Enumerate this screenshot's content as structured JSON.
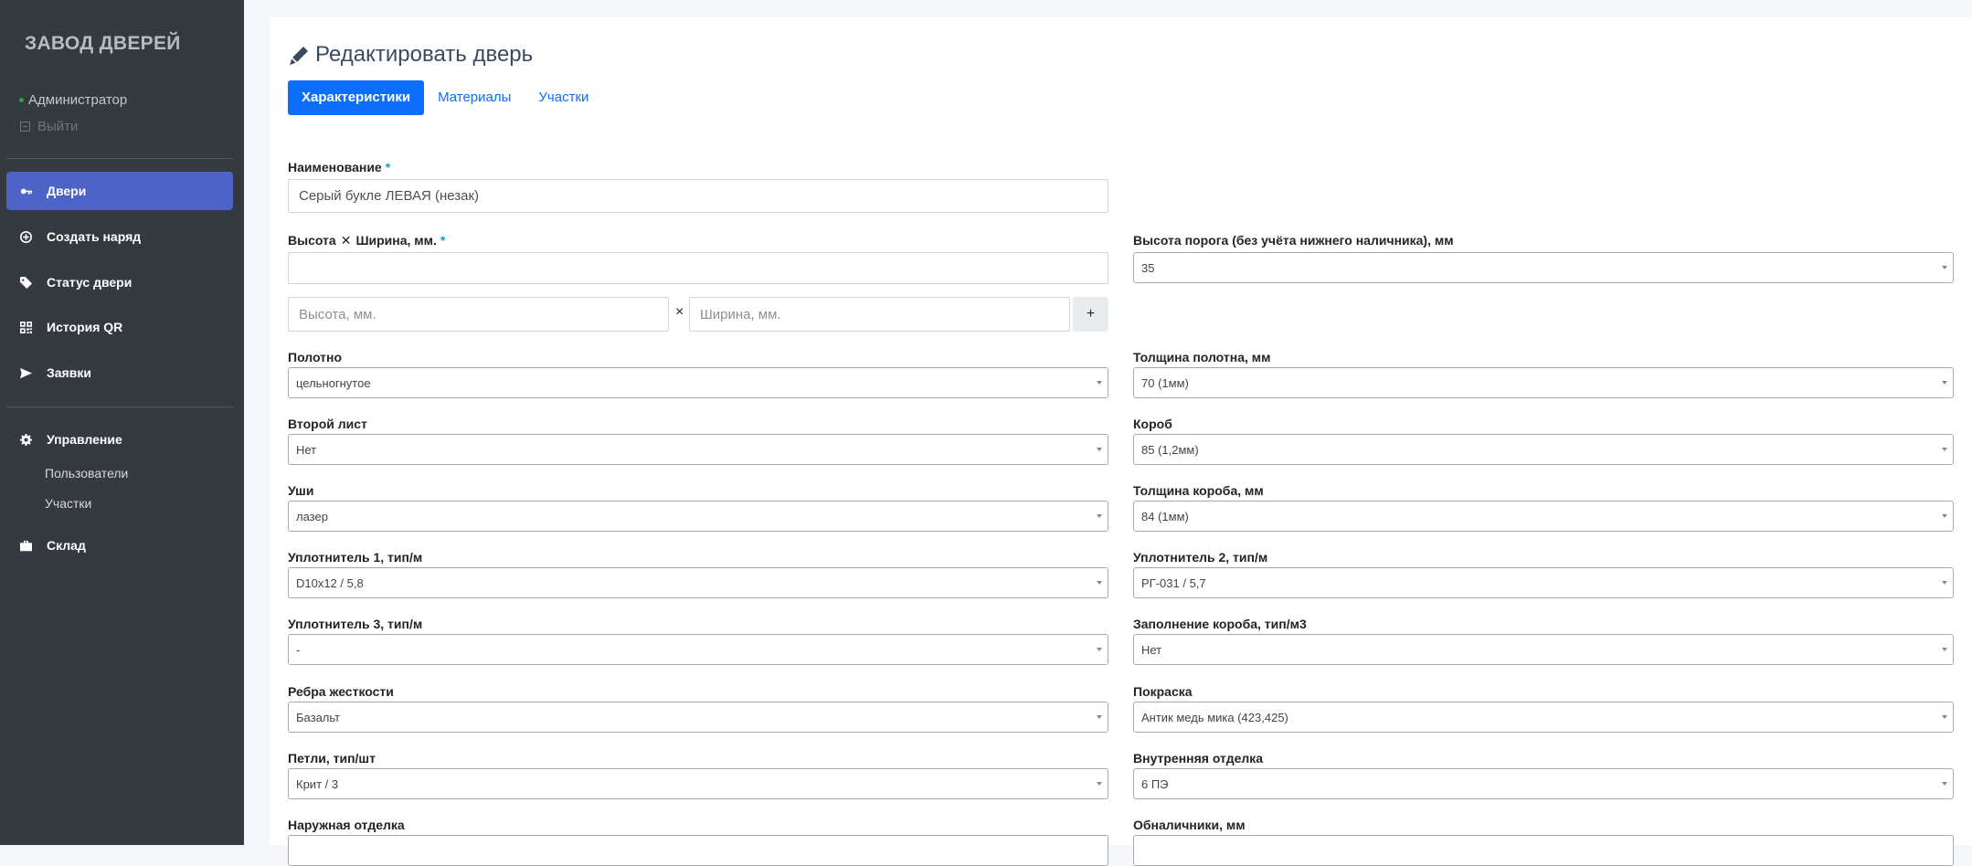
{
  "sidebar": {
    "brand": "ЗАВОД ДВЕРЕЙ",
    "user": "Администратор",
    "logout": "Выйти",
    "nav": [
      {
        "label": "Двери",
        "icon": "key-icon"
      },
      {
        "label": "Создать наряд",
        "icon": "plus-circle-icon"
      },
      {
        "label": "Статус двери",
        "icon": "tag-icon"
      },
      {
        "label": "История QR",
        "icon": "qrcode-icon"
      },
      {
        "label": "Заявки",
        "icon": "paper-plane-icon"
      }
    ],
    "management": {
      "label": "Управление",
      "icon": "gear-icon"
    },
    "sub_items": [
      "Пользователи",
      "Участки"
    ],
    "warehouse": {
      "label": "Склад",
      "icon": "briefcase-icon"
    }
  },
  "main": {
    "title": "Редактировать дверь",
    "tabs": [
      "Характеристики",
      "Материалы",
      "Участки"
    ],
    "name": {
      "label": "Наименование",
      "value": "Серый букле ЛЕВАЯ (незак)"
    },
    "size": {
      "label_height": "Высота",
      "times": "✕",
      "label_width": "Ширина, мм.",
      "height_placeholder": "Высота, мм.",
      "width_placeholder": "Ширина, мм.",
      "times_small": "×",
      "add": "+"
    },
    "required_mark": "*",
    "threshold": {
      "label": "Высота порога (без учёта нижнего наличника), мм",
      "value": "35"
    },
    "left_fields": [
      {
        "label": "Полотно",
        "value": "цельногнутое"
      },
      {
        "label": "Второй лист",
        "value": "Нет"
      },
      {
        "label": "Уши",
        "value": "лазер"
      },
      {
        "label": "Уплотнитель 1, тип/м",
        "value": "D10x12 / 5,8"
      },
      {
        "label": "Уплотнитель 3, тип/м",
        "value": "-"
      },
      {
        "label": "Ребра жесткости",
        "value": "Базальт"
      },
      {
        "label": "Петли, тип/шт",
        "value": "Крит / 3"
      },
      {
        "label": "Наружная отделка",
        "value": ""
      }
    ],
    "right_fields": [
      {
        "label": "Толщина полотна, мм",
        "value": "70 (1мм)"
      },
      {
        "label": "Короб",
        "value": "85 (1,2мм)"
      },
      {
        "label": "Толщина короба, мм",
        "value": "84 (1мм)"
      },
      {
        "label": "Уплотнитель 2, тип/м",
        "value": "РГ-031 / 5,7"
      },
      {
        "label": "Заполнение короба, тип/м3",
        "value": "Нет"
      },
      {
        "label": "Покраска",
        "value": "Антик медь мика (423,425)"
      },
      {
        "label": "Внутренняя отделка",
        "value": "6 ПЭ"
      },
      {
        "label": "Обналичники, мм",
        "value": ""
      }
    ]
  }
}
